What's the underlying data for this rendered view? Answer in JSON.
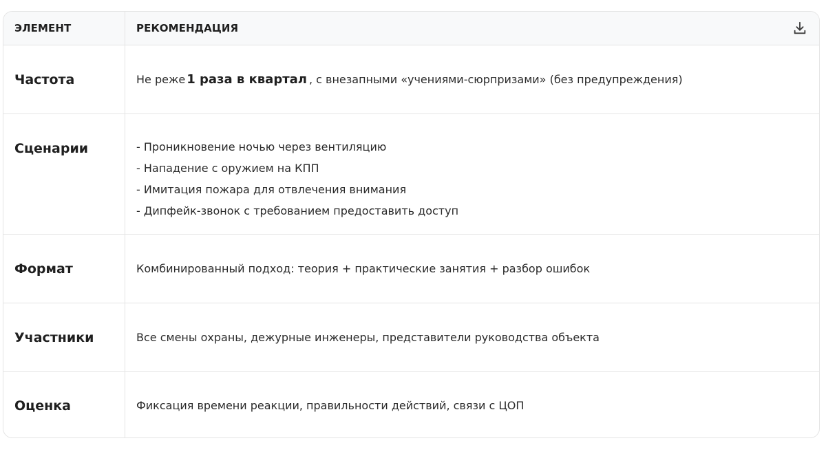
{
  "table": {
    "headers": {
      "element": "ЭЛЕМЕНТ",
      "recommendation": "РЕКОМЕНДАЦИЯ"
    },
    "download_icon": "download-icon",
    "rows": [
      {
        "element": "Частота",
        "rec_prefix": "Не реже",
        "rec_emphasis": "1 раза в квартал",
        "rec_suffix": ", с внезапными «учениями-сюрпризами» (без предупреждения)"
      },
      {
        "element": "Сценарии",
        "items": [
          "- Проникновение ночью через вентиляцию",
          "- Нападение с оружием на КПП",
          "- Имитация пожара для отвлечения внимания",
          "- Дипфейк-звонок с требованием предоставить доступ"
        ]
      },
      {
        "element": "Формат",
        "text": "Комбинированный подход: теория + практические занятия + разбор ошибок"
      },
      {
        "element": "Участники",
        "text": "Все смены охраны, дежурные инженеры, представители руководства объекта"
      },
      {
        "element": "Оценка",
        "text": "Фиксация времени реакции, правильности действий, связи с ЦОП"
      }
    ]
  }
}
